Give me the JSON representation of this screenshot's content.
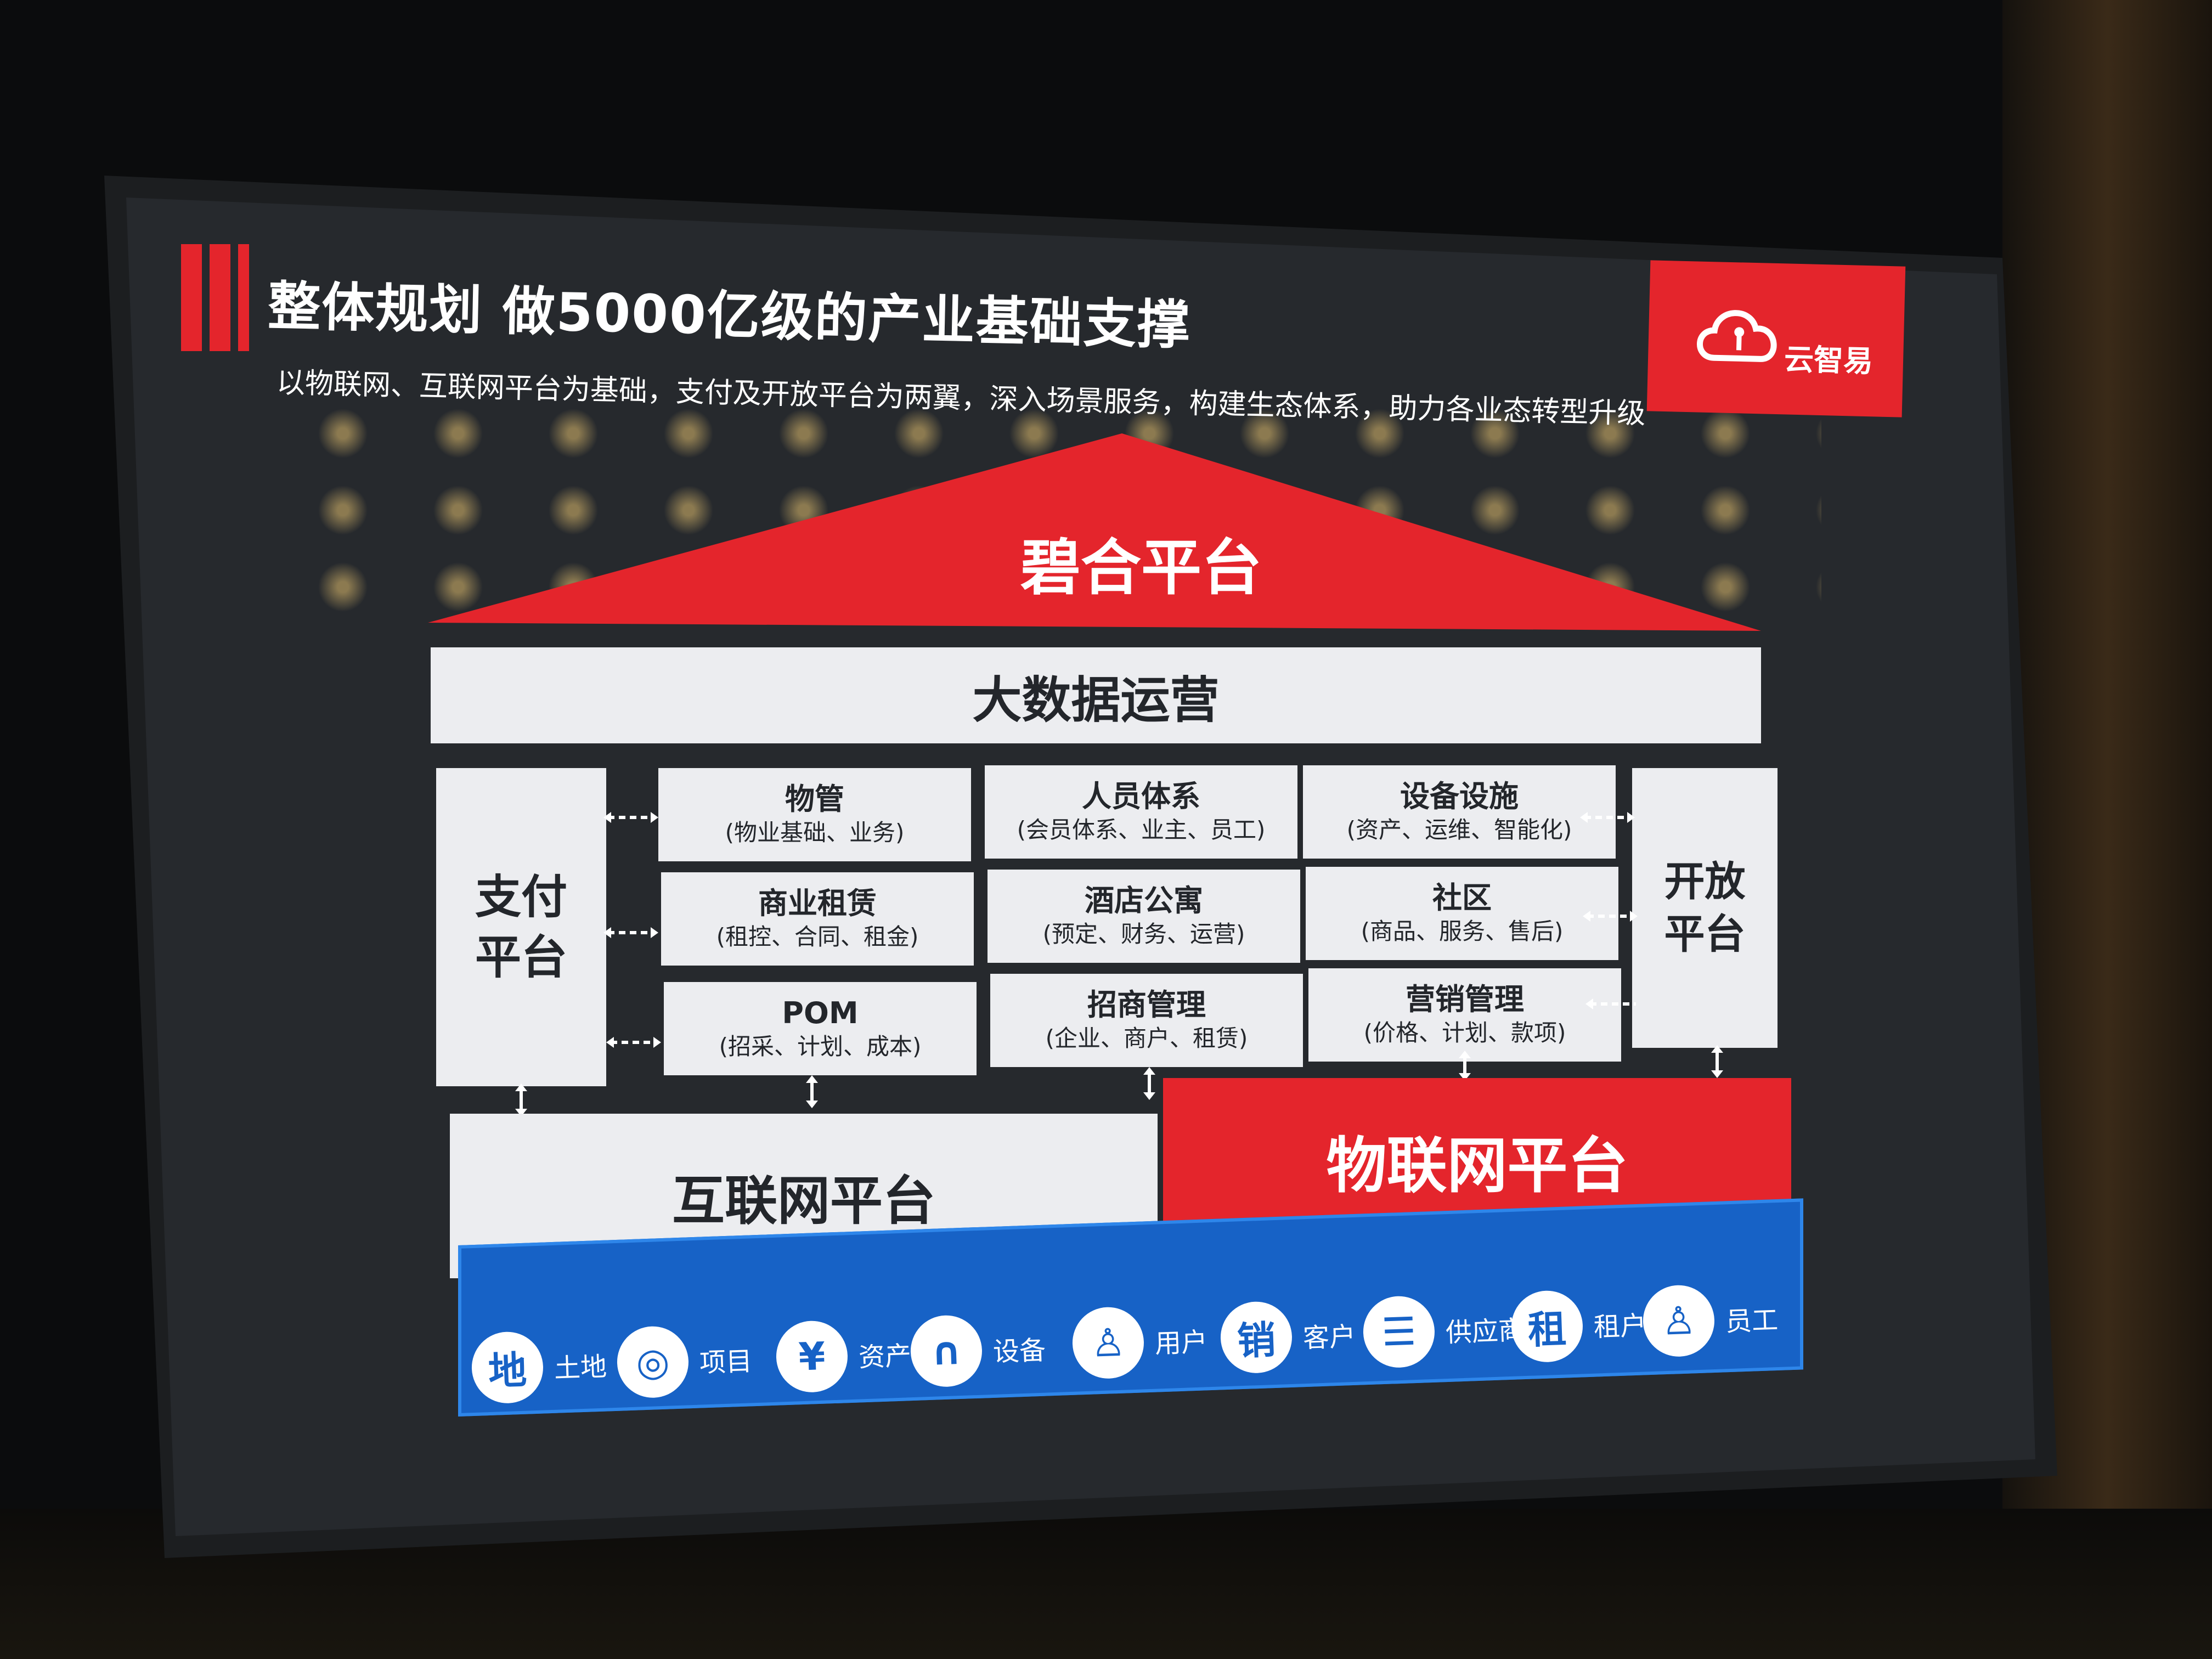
{
  "slide": {
    "title": "整体规划  做5000亿级的产业基础支撑",
    "subtitle": "以物联网、互联网平台为基础，支付及开放平台为两翼，深入场景服务，构建生态体系，助力各业态转型升级",
    "logo_text": "云智易",
    "roof_label": "碧合平台",
    "bigdata_label": "大数据运营",
    "pay_platform": [
      "支付",
      "平台"
    ],
    "open_platform": [
      "开放",
      "平台"
    ],
    "modules": [
      {
        "title": "物管",
        "sub": "(物业基础、业务)"
      },
      {
        "title": "人员体系",
        "sub": "(会员体系、业主、员工)"
      },
      {
        "title": "设备设施",
        "sub": "(资产、运维、智能化)"
      },
      {
        "title": "商业租赁",
        "sub": "(租控、合同、租金)"
      },
      {
        "title": "酒店公寓",
        "sub": "(预定、财务、运营)"
      },
      {
        "title": "社区",
        "sub": "(商品、服务、售后)"
      },
      {
        "title": "POM",
        "sub": "(招采、计划、成本)"
      },
      {
        "title": "招商管理",
        "sub": "(企业、商户、租赁)"
      },
      {
        "title": "营销管理",
        "sub": "(价格、计划、款项)"
      }
    ],
    "internet_platform": "互联网平台",
    "iot_platform": "物联网平台",
    "icons": [
      {
        "glyph": "地",
        "label": "土地",
        "icon": "land-icon"
      },
      {
        "glyph": "◎",
        "label": "项目",
        "icon": "project-icon"
      },
      {
        "glyph": "¥",
        "label": "资产",
        "icon": "asset-icon"
      },
      {
        "glyph": "∩",
        "label": "设备",
        "icon": "device-icon"
      },
      {
        "glyph": "♙",
        "label": "用户",
        "icon": "user-icon"
      },
      {
        "glyph": "销",
        "label": "客户",
        "icon": "customer-icon"
      },
      {
        "glyph": "☰",
        "label": "供应商",
        "icon": "supplier-icon"
      },
      {
        "glyph": "租",
        "label": "租户",
        "icon": "tenant-icon"
      },
      {
        "glyph": "♙",
        "label": "员工",
        "icon": "staff-icon"
      }
    ],
    "colors": {
      "accent_red": "#e4252c",
      "strip_blue": "#1762c6",
      "block_white": "#ecedf0"
    }
  }
}
